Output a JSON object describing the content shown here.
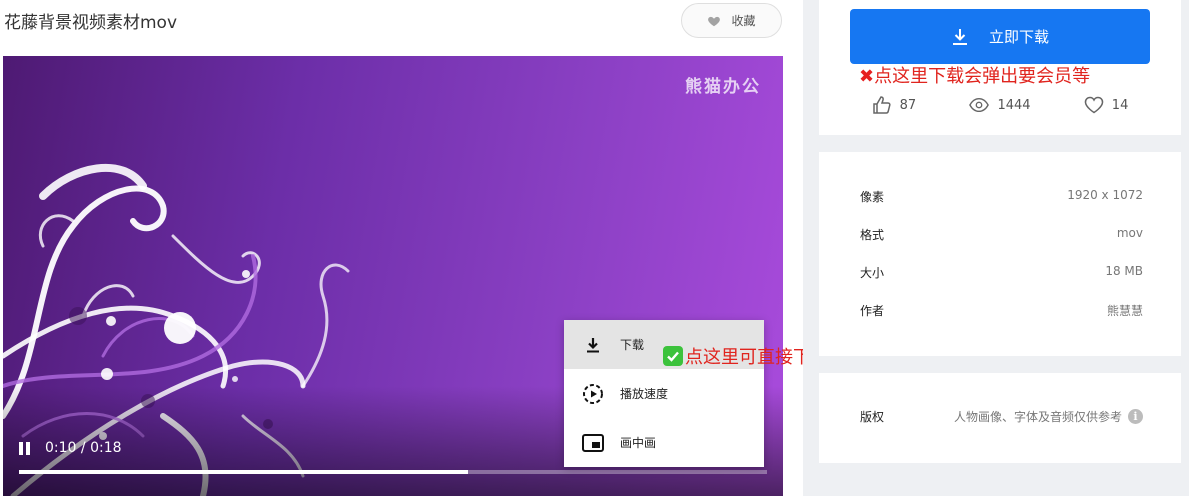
{
  "page": {
    "title": "花藤背景视频素材mov",
    "favorite_label": "收藏"
  },
  "video": {
    "watermark": "熊猫办公",
    "current_time": "0:10",
    "separator": "/",
    "duration": "0:18",
    "progress_fraction": 0.6,
    "context_menu": [
      {
        "label": "下载",
        "icon": "download-icon"
      },
      {
        "label": "播放速度",
        "icon": "playback-speed-icon"
      },
      {
        "label": "画中画",
        "icon": "picture-in-picture-icon"
      }
    ]
  },
  "annotations": {
    "direct_download": "点这里可直接下载",
    "member_popup": "点这里下载会弹出要会员等"
  },
  "sidebar": {
    "download_button": "立即下载",
    "stats": {
      "likes": "87",
      "views": "1444",
      "favorites": "14"
    },
    "meta": [
      {
        "key": "像素",
        "value": "1920 x 1072"
      },
      {
        "key": "格式",
        "value": "mov"
      },
      {
        "key": "大小",
        "value": "18 MB"
      },
      {
        "key": "作者",
        "value": "熊慧慧"
      }
    ],
    "copyright": {
      "key": "版权",
      "value": "人物画像、字体及音频仅供参考"
    }
  },
  "colors": {
    "accent": "#1677f2",
    "annotation_red": "#e0241e",
    "video_purple": "#7a35b5",
    "sidebar_bg": "#eef0f3"
  }
}
